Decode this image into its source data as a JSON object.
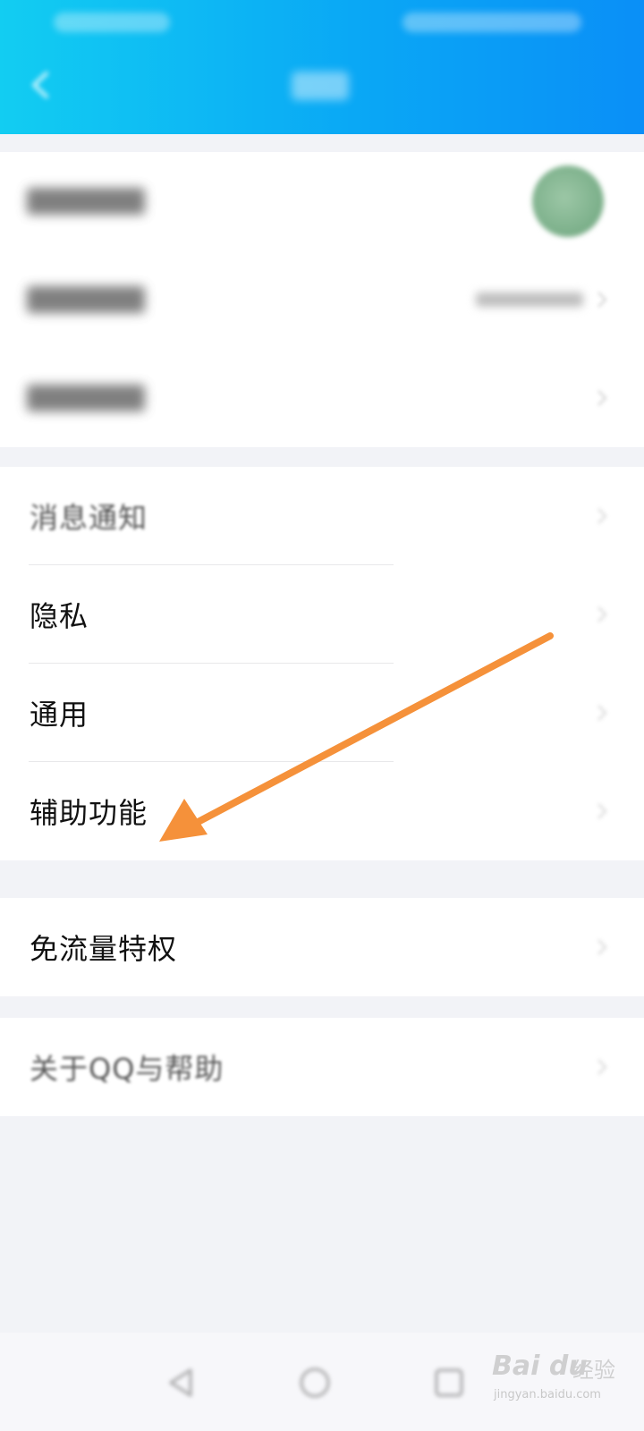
{
  "header": {
    "title": "",
    "colors": {
      "gradient_start": "#12cdf2",
      "gradient_end": "#0a8ff7"
    }
  },
  "icons": {
    "back": "chevron-left-icon",
    "row_arrow": "chevron-right-icon",
    "nav": [
      "back-triangle-icon",
      "home-circle-icon",
      "recents-square-icon"
    ]
  },
  "account_group": {
    "items": [
      {
        "label": "",
        "accessory": "avatar"
      },
      {
        "label": "",
        "accessory": "value"
      },
      {
        "label": "",
        "accessory": "chevron"
      }
    ]
  },
  "settings_group": {
    "items": [
      {
        "label": "消息通知"
      },
      {
        "label": "隐私"
      },
      {
        "label": "通用"
      },
      {
        "label": "辅助功能"
      }
    ]
  },
  "data_group": {
    "items": [
      {
        "label": "免流量特权"
      }
    ]
  },
  "about_group": {
    "items": [
      {
        "label": "关于QQ与帮助"
      }
    ]
  },
  "annotation": {
    "color": "#f5913a",
    "points_to": "辅助功能"
  },
  "watermark": {
    "logo": "Bai du",
    "cn": "经验",
    "url": "jingyan.baidu.com"
  }
}
